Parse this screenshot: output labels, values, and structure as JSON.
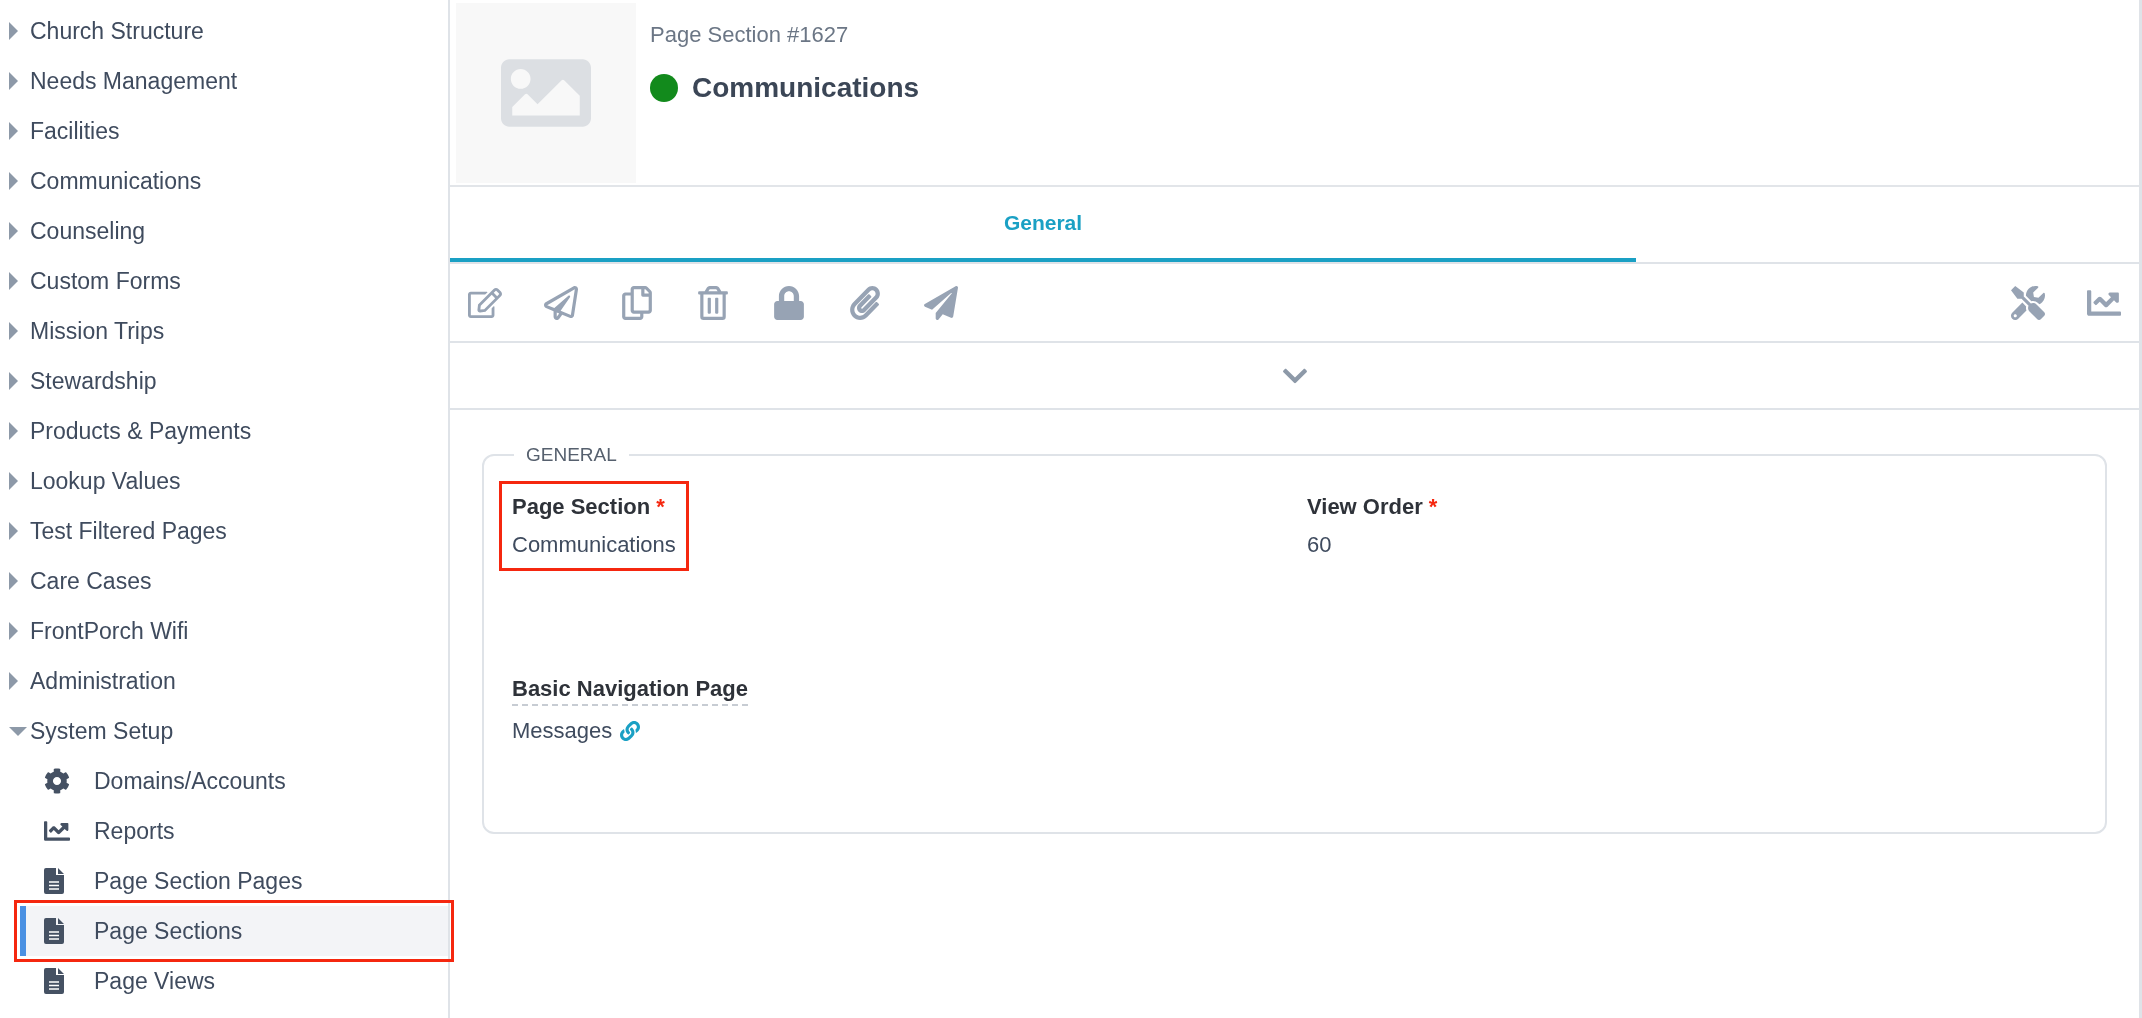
{
  "sidebar": {
    "items": [
      {
        "label": "Church Structure",
        "expanded": false
      },
      {
        "label": "Needs Management",
        "expanded": false
      },
      {
        "label": "Facilities",
        "expanded": false
      },
      {
        "label": "Communications",
        "expanded": false
      },
      {
        "label": "Counseling",
        "expanded": false
      },
      {
        "label": "Custom Forms",
        "expanded": false
      },
      {
        "label": "Mission Trips",
        "expanded": false
      },
      {
        "label": "Stewardship",
        "expanded": false
      },
      {
        "label": "Products & Payments",
        "expanded": false
      },
      {
        "label": "Lookup Values",
        "expanded": false
      },
      {
        "label": "Test Filtered Pages",
        "expanded": false
      },
      {
        "label": "Care Cases",
        "expanded": false
      },
      {
        "label": "FrontPorch Wifi",
        "expanded": false
      },
      {
        "label": "Administration",
        "expanded": false
      },
      {
        "label": "System Setup",
        "expanded": true,
        "children": [
          {
            "label": "Domains/Accounts",
            "kind": "settings",
            "selected": false,
            "highlighted": false
          },
          {
            "label": "Reports",
            "kind": "chart",
            "selected": false,
            "highlighted": false
          },
          {
            "label": "Page Section Pages",
            "kind": "document",
            "selected": false,
            "highlighted": false
          },
          {
            "label": "Page Sections",
            "kind": "document",
            "selected": true,
            "highlighted": true
          },
          {
            "label": "Page Views",
            "kind": "document",
            "selected": false,
            "highlighted": false
          }
        ]
      }
    ]
  },
  "header": {
    "subtitle": "Page Section #1627",
    "title": "Communications",
    "active": true
  },
  "tabs": [
    {
      "label": "General",
      "selected": true
    }
  ],
  "form": {
    "legend": "GENERAL",
    "required_mark": "*",
    "fields": [
      {
        "label": "Page Section",
        "value": "Communications",
        "kind": "text",
        "required": true,
        "highlighted": true
      },
      {
        "label": "View Order",
        "value": "60",
        "kind": "text",
        "required": true,
        "highlighted": false
      },
      {
        "label": "Basic Navigation Page",
        "value": "Messages",
        "kind": "link",
        "required": false,
        "highlighted": false
      }
    ]
  }
}
